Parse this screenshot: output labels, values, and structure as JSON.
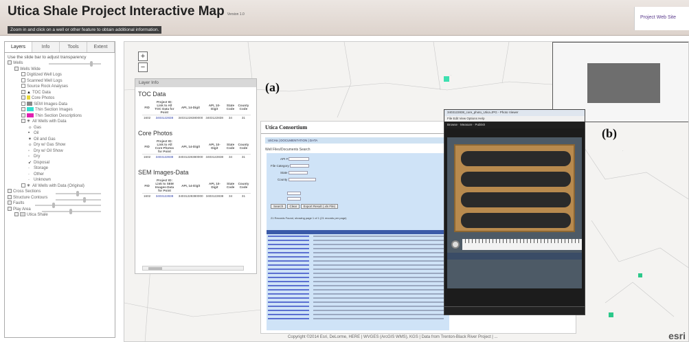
{
  "app": {
    "title": "Utica Shale Project Interactive Map",
    "version": "Version 1.0",
    "subtitle": "Zoom in and click on a well or other feature to obtain additional information.",
    "header_link": "Project Web Site"
  },
  "sidebar": {
    "tabs": [
      "Layers",
      "Info",
      "Tools",
      "Extent"
    ],
    "instructions": "Use the slide bar to adjust transparency",
    "tree": {
      "wells": "Wells",
      "wells_wide": "Wells Wide",
      "digitized_logs": "Digitized Well Logs",
      "scanned_logs": "Scanned Well Logs",
      "source_rock": "Source Rock Analyses",
      "toc": "TOC Data",
      "core_photos": "Core Photos",
      "sem": "SEM Images-Data",
      "thin_images": "Thin Section Images",
      "thin_desc": "Thin Section Descriptions",
      "all_wells": "All Wells with Data",
      "legend": [
        "Gas",
        "Oil",
        "Oil and Gas",
        "Dry w/ Gas Show",
        "Dry w/ Oil Show",
        "Dry",
        "Disposal",
        "Storage",
        "Other",
        "Unknown"
      ],
      "all_wells_orig": "All Wells with Data (Original)",
      "cross_sections": "Cross Sections",
      "structure": "Structure Contours",
      "faults": "Faults",
      "play_area": "Play Area",
      "utica_shale": "Utica Shale"
    },
    "colors": {
      "toc": "#222222",
      "core": "#e8d838",
      "sem": "#888888",
      "thin_images": "#33e0d0",
      "thin_desc": "#e020b0"
    }
  },
  "map": {
    "zoom_in": "+",
    "zoom_out": "−",
    "figure_a": "(a)",
    "figure_b": "(b)",
    "copyright": "Copyright ©2014 Esri, DeLorme, HERE | WVGES (ArcGIS WMS), KGS | Data from Trenton-Black River Project | ...",
    "esri": "esri"
  },
  "layer_info": {
    "header": "Layer Info",
    "sections": [
      {
        "title": "TOC Data",
        "columns": [
          "FID",
          "Project ID: Link to All TOC Data for Point",
          "API, 14-Digit",
          "API, 10-Digit",
          "State Code",
          "County Code"
        ],
        "rows": [
          [
            "1602",
            "3403122838",
            "34031228380000",
            "3403122838",
            "34",
            "31"
          ]
        ]
      },
      {
        "title": "Core Photos",
        "columns": [
          "FID",
          "Project ID: Link to All Core Photos for Point",
          "API, 14-Digit",
          "API, 10-Digit",
          "State Code",
          "County Code"
        ],
        "rows": [
          [
            "1602",
            "3403122838",
            "34031228380000",
            "3403122838",
            "34",
            "31"
          ]
        ]
      },
      {
        "title": "SEM Images-Data",
        "columns": [
          "FID",
          "Project ID: Link to SEM Images-Data for Point",
          "API, 14-Digit",
          "API, 10-Digit",
          "State Code",
          "County Code"
        ],
        "rows": [
          [
            "1602",
            "3403122838",
            "34031228380000",
            "3403122838",
            "34",
            "31"
          ]
        ]
      }
    ]
  },
  "consortium": {
    "title": "Utica Consortium",
    "nav": "UtiCHa | DOCUMENTATION | DATA",
    "subtitle": "Well Files/Documents Search",
    "form_labels": [
      "API #",
      "File Category",
      "State",
      "County"
    ],
    "search_btn": "Search",
    "clear_btn": "Clear",
    "export_btn": "Export Result (.xls File)",
    "records": "21 Records Found, showing page 1 of 1 (21 records per page)"
  },
  "viewer": {
    "title": "3403122838_core_photo_Utica.JPG - Photo Viewer",
    "menu": "File  Edit  View  Options  Help",
    "toolbar": "Browse  ·  Measure  ·  Publish"
  }
}
